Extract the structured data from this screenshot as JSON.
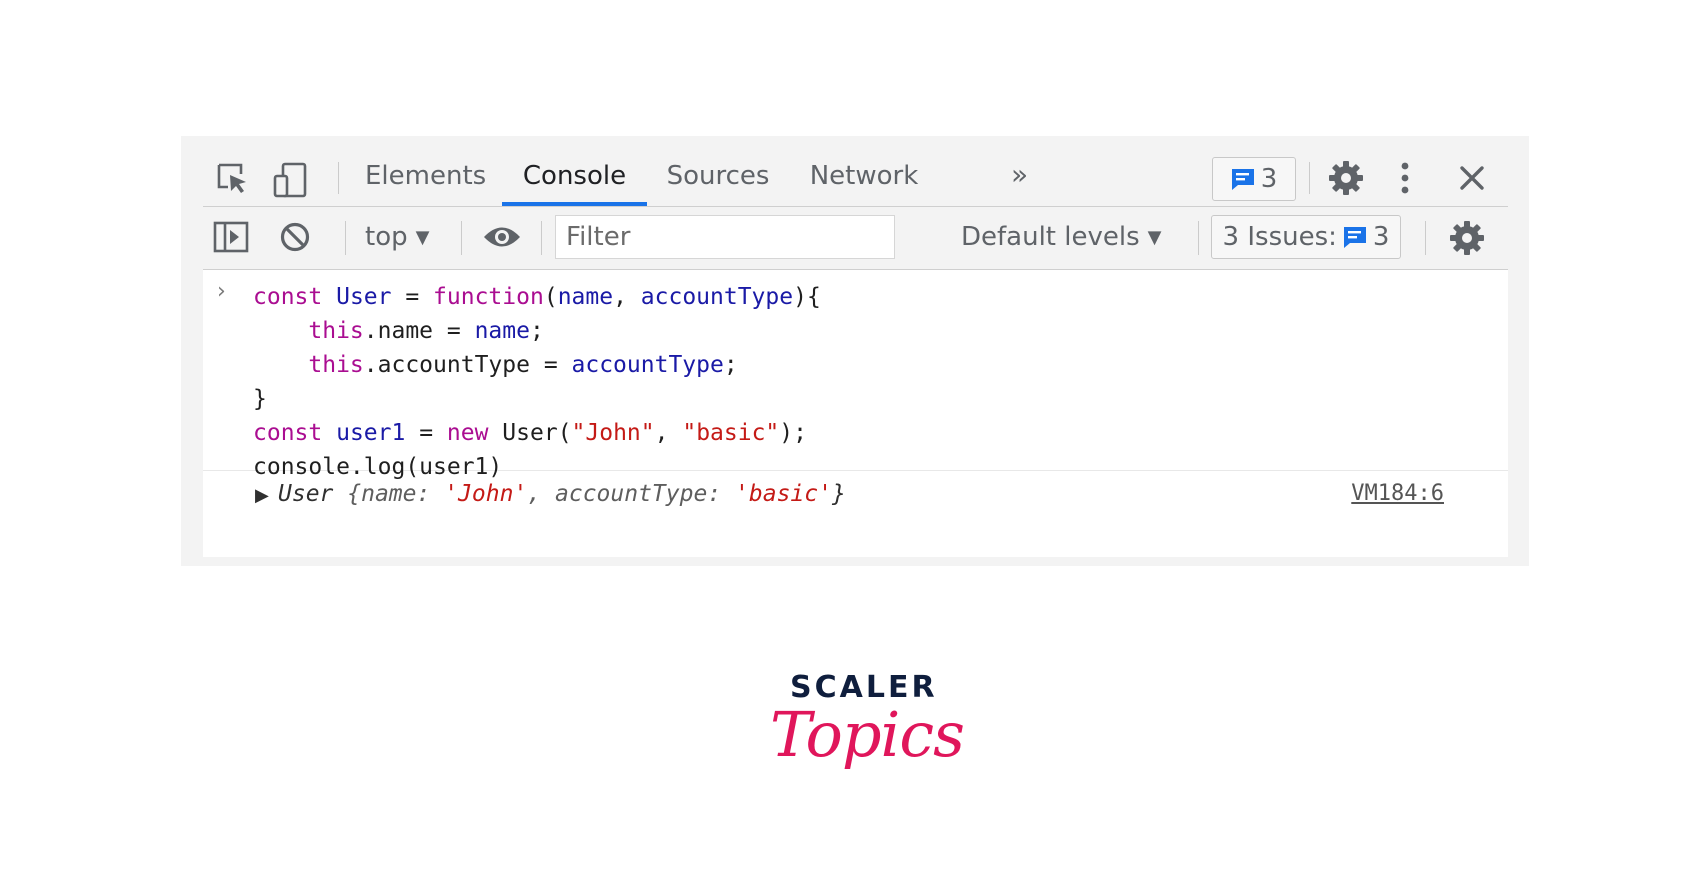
{
  "tabs": [
    {
      "label": "Elements",
      "active": false
    },
    {
      "label": "Console",
      "active": true
    },
    {
      "label": "Sources",
      "active": false
    },
    {
      "label": "Network",
      "active": false
    }
  ],
  "tab_overflow": "»",
  "message_badge": {
    "count": "3"
  },
  "toolbar": {
    "context": "top",
    "filter_placeholder": "Filter",
    "levels": "Default levels",
    "issues_label": "3 Issues:",
    "issues_count": "3"
  },
  "console": {
    "prompt": "›",
    "code_lines": [
      [
        {
          "t": "const",
          "c": "kw"
        },
        {
          "t": " "
        },
        {
          "t": "User",
          "c": "vr"
        },
        {
          "t": " = "
        },
        {
          "t": "function",
          "c": "kw"
        },
        {
          "t": "("
        },
        {
          "t": "name",
          "c": "vr"
        },
        {
          "t": ", "
        },
        {
          "t": "accountType",
          "c": "vr"
        },
        {
          "t": "){"
        }
      ],
      [
        {
          "t": "    "
        },
        {
          "t": "this",
          "c": "kw"
        },
        {
          "t": "."
        },
        {
          "t": "name"
        },
        {
          "t": " = "
        },
        {
          "t": "name",
          "c": "vr"
        },
        {
          "t": ";"
        }
      ],
      [
        {
          "t": "    "
        },
        {
          "t": "this",
          "c": "kw"
        },
        {
          "t": "."
        },
        {
          "t": "accountType"
        },
        {
          "t": " = "
        },
        {
          "t": "accountType",
          "c": "vr"
        },
        {
          "t": ";"
        }
      ],
      [
        {
          "t": "}"
        }
      ],
      [
        {
          "t": "const",
          "c": "kw"
        },
        {
          "t": " "
        },
        {
          "t": "user1",
          "c": "vr"
        },
        {
          "t": " = "
        },
        {
          "t": "new",
          "c": "kw"
        },
        {
          "t": " User("
        },
        {
          "t": "\"John\"",
          "c": "st"
        },
        {
          "t": ", "
        },
        {
          "t": "\"basic\"",
          "c": "st"
        },
        {
          "t": ");"
        }
      ],
      [
        {
          "t": "console.log(user1)"
        }
      ]
    ],
    "output": {
      "class_name": "User",
      "open": "{",
      "key1": "name",
      "value1": "'John'",
      "key2": "accountType",
      "value2": "'basic'",
      "close": "}"
    },
    "source_link": "VM184:6"
  },
  "logo": {
    "line1": "SCALER",
    "line2": "Topics"
  },
  "colors": {
    "accent": "#1a73e8",
    "logo_pink": "#e0165b",
    "logo_navy": "#0f1e3d"
  }
}
